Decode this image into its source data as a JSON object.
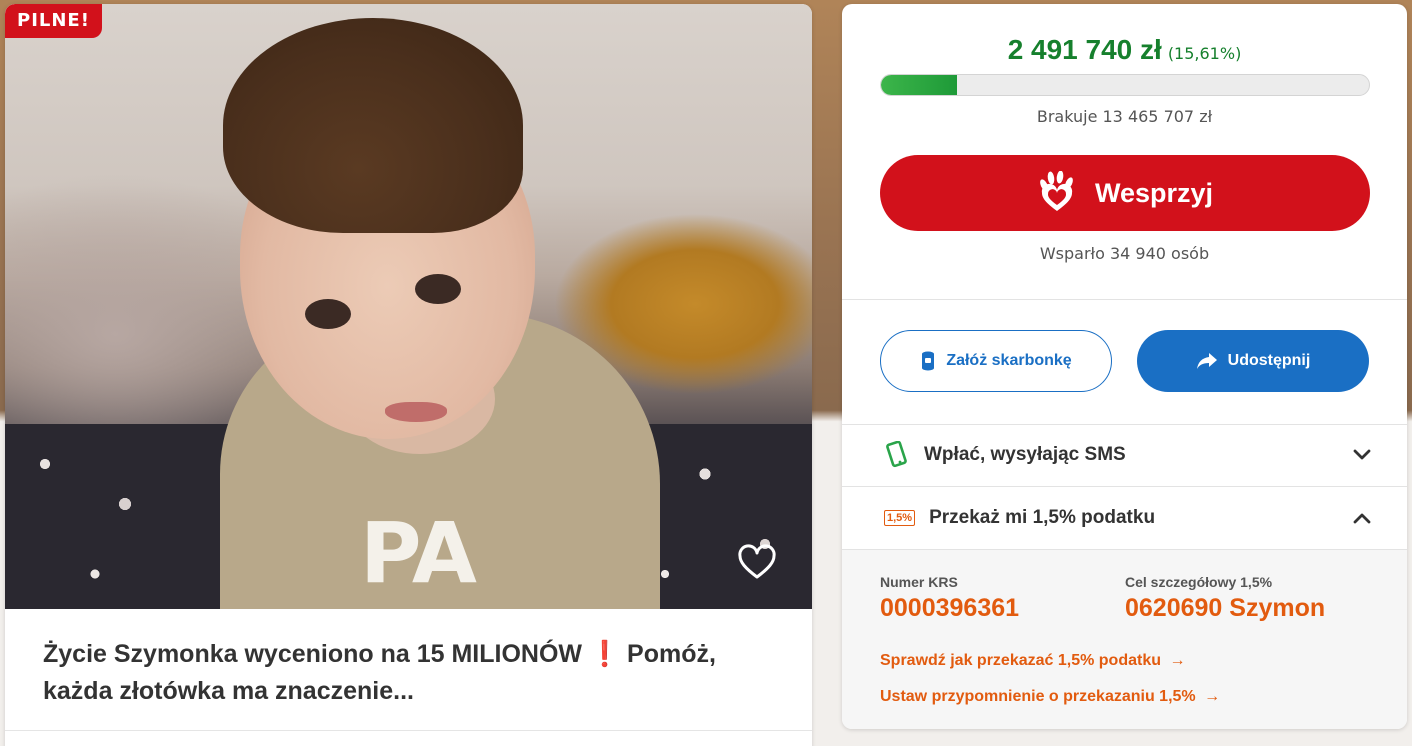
{
  "campaign": {
    "badge": "PILNE!",
    "title": "Życie Szymonka wyceniono na 15 MILIONÓW ❗ Pomóż, każda złotówka ma znaczenie..."
  },
  "funding": {
    "amount": "2 491 740 zł",
    "percent": "(15,61%)",
    "progress_fraction": 0.1561,
    "missing": "Brakuje 13 465 707 zł",
    "support_label": "Wesprzyj",
    "supporters": "Wsparło 34 940 osób"
  },
  "actions": {
    "piggybank": "Załóż skarbonkę",
    "share": "Udostępnij"
  },
  "accordion": {
    "sms": "Wpłać, wysyłając SMS",
    "tax": "Przekaż mi 1,5% podatku",
    "tax_icon_text": "1,5%"
  },
  "tax_details": {
    "krs_caption": "Numer KRS",
    "krs_value": "0000396361",
    "goal_caption": "Cel szczegółowy 1,5%",
    "goal_value": "0620690 Szymon",
    "link_check": "Sprawdź jak przekazać 1,5% podatku",
    "link_remind": "Ustaw przypomnienie o przekazaniu 1,5%"
  },
  "colors": {
    "brand_red": "#d2111b",
    "money_green": "#16802d",
    "action_blue": "#1a6fc4",
    "link_orange": "#e25b0f"
  },
  "icons": [
    "heart-icon",
    "heart-hand-icon",
    "piggybank-icon",
    "share-arrow-icon",
    "phone-icon",
    "tax-percent-icon",
    "chevron-down-icon",
    "chevron-up-icon",
    "arrow-right-icon"
  ]
}
